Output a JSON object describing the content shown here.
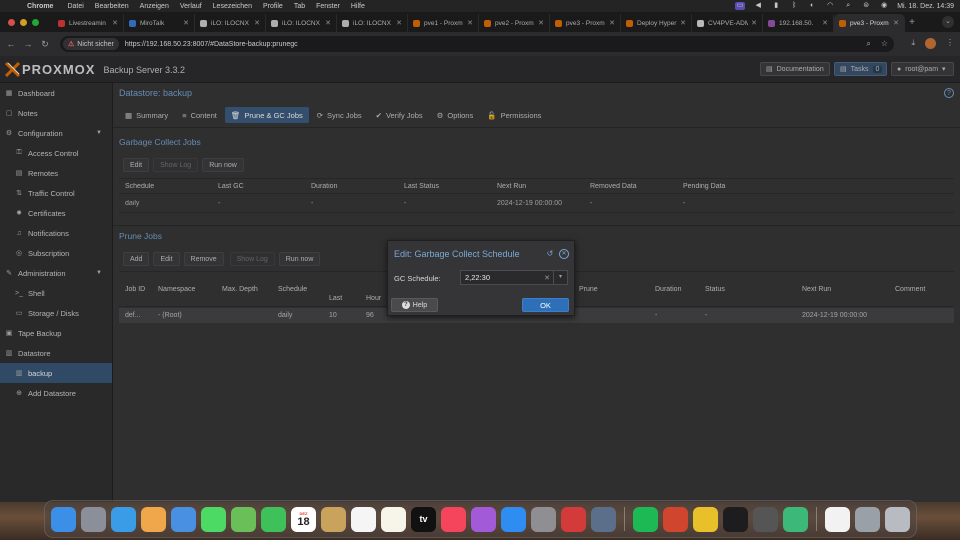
{
  "menubar": {
    "app": "Chrome",
    "items": [
      "Datei",
      "Bearbeiten",
      "Anzeigen",
      "Verlauf",
      "Lesezeichen",
      "Profile",
      "Tab",
      "Fenster",
      "Hilfe"
    ],
    "clock": "Mi. 18. Dez.  14:39"
  },
  "browser": {
    "tabs": [
      {
        "title": "Livestreamin",
        "color": "#e23b3b",
        "active": false
      },
      {
        "title": "MiroTalk",
        "color": "#3b7fe2",
        "active": false
      },
      {
        "title": "iLO: ILOCNX",
        "color": "#cfcfcf",
        "active": false
      },
      {
        "title": "iLO: ILOCNX",
        "color": "#cfcfcf",
        "active": false
      },
      {
        "title": "iLO: ILOCNX",
        "color": "#cfcfcf",
        "active": false
      },
      {
        "title": "pve1 - Proxm",
        "color": "#e57000",
        "active": false
      },
      {
        "title": "pve2 - Proxm",
        "color": "#e57000",
        "active": false
      },
      {
        "title": "pve3 - Proxm",
        "color": "#e57000",
        "active": false
      },
      {
        "title": "Deploy Hyper",
        "color": "#e57000",
        "active": false
      },
      {
        "title": "CV4PVE-ADM",
        "color": "#dddddd",
        "active": false
      },
      {
        "title": "192.168.50.",
        "color": "#9b59b6",
        "active": false
      },
      {
        "title": "pve3 - Proxm",
        "color": "#e57000",
        "active": true
      }
    ],
    "security_label": "Nicht sicher",
    "url": "https://192.168.50.23:8007/#DataStore-backup:prunegc"
  },
  "header": {
    "logo": "PROXMOX",
    "product": "Backup Server 3.3.2",
    "documentation": "Documentation",
    "tasks": "Tasks",
    "tasks_count": "0",
    "user": "root@pam"
  },
  "nav": {
    "items": [
      {
        "label": "Dashboard",
        "icon": "dashboard-icon",
        "glyph": "▦",
        "level": 0
      },
      {
        "label": "Notes",
        "icon": "notes-icon",
        "glyph": "▢",
        "level": 0
      },
      {
        "label": "Configuration",
        "icon": "gears-icon",
        "glyph": "⚙",
        "level": 0,
        "expanded": true
      },
      {
        "label": "Access Control",
        "icon": "key-icon",
        "glyph": "⚿",
        "level": 1
      },
      {
        "label": "Remotes",
        "icon": "server-icon",
        "glyph": "▤",
        "level": 1
      },
      {
        "label": "Traffic Control",
        "icon": "traffic-icon",
        "glyph": "⇅",
        "level": 1
      },
      {
        "label": "Certificates",
        "icon": "certificate-icon",
        "glyph": "✹",
        "level": 1
      },
      {
        "label": "Notifications",
        "icon": "bell-icon",
        "glyph": "♫",
        "level": 1
      },
      {
        "label": "Subscription",
        "icon": "support-icon",
        "glyph": "◎",
        "level": 1
      },
      {
        "label": "Administration",
        "icon": "wrench-icon",
        "glyph": "✎",
        "level": 0,
        "expanded": true
      },
      {
        "label": "Shell",
        "icon": "terminal-icon",
        "glyph": ">_",
        "level": 1
      },
      {
        "label": "Storage / Disks",
        "icon": "hdd-icon",
        "glyph": "▭",
        "level": 1
      },
      {
        "label": "Tape Backup",
        "icon": "tape-icon",
        "glyph": "▣",
        "level": 0
      },
      {
        "label": "Datastore",
        "icon": "database-icon",
        "glyph": "▥",
        "level": 0
      },
      {
        "label": "backup",
        "icon": "datastore-icon",
        "glyph": "▥",
        "level": 1,
        "selected": true
      },
      {
        "label": "Add Datastore",
        "icon": "plus-circle-icon",
        "glyph": "⊕",
        "level": 1
      }
    ]
  },
  "main": {
    "title": "Datastore: backup",
    "tabs": [
      {
        "label": "Summary",
        "icon": "book-icon",
        "glyph": "▦"
      },
      {
        "label": "Content",
        "icon": "list-icon",
        "glyph": "≡"
      },
      {
        "label": "Prune & GC Jobs",
        "icon": "trash-icon",
        "glyph": "🗑",
        "active": true
      },
      {
        "label": "Sync Jobs",
        "icon": "refresh-icon",
        "glyph": "⟳"
      },
      {
        "label": "Verify Jobs",
        "icon": "check-circle-icon",
        "glyph": "✔"
      },
      {
        "label": "Options",
        "icon": "gear-icon",
        "glyph": "⚙"
      },
      {
        "label": "Permissions",
        "icon": "unlock-icon",
        "glyph": "🔓"
      }
    ],
    "gc": {
      "title": "Garbage Collect Jobs",
      "buttons": [
        "Edit",
        "Show Log",
        "Run now"
      ],
      "columns": [
        "Schedule",
        "Last GC",
        "Duration",
        "Last Status",
        "Next Run",
        "Removed Data",
        "Pending Data"
      ],
      "row": [
        "daily",
        "-",
        "-",
        "-",
        "2024-12-19 00:00:00",
        "-",
        "-"
      ]
    },
    "prune": {
      "title": "Prune Jobs",
      "buttons": [
        "Add",
        "Edit",
        "Remove",
        "Show Log",
        "Run now"
      ],
      "columns": [
        "Job ID",
        "Namespace",
        "Max. Depth",
        "Schedule",
        "Last",
        "Hour",
        "Prune",
        "Duration",
        "Status",
        "Next Run",
        "Comment"
      ],
      "row": {
        "job_id": "def...",
        "namespace": "- (Root)",
        "max_depth": "",
        "schedule": "daily",
        "last": "10",
        "hour": "96",
        "duration": "-",
        "status": "-",
        "next_run": "2024-12-19 00:00:00"
      }
    }
  },
  "dialog": {
    "title": "Edit: Garbage Collect Schedule",
    "field_label": "GC Schedule:",
    "field_value": "2,22:30",
    "help": "Help",
    "ok": "OK"
  },
  "dock": {
    "calendar_month": "DEZ",
    "calendar_day": "18",
    "tv_label": "tv",
    "apps": [
      {
        "name": "finder-icon",
        "color": "#3b8fe6"
      },
      {
        "name": "launchpad-icon",
        "color": "#8a8f99"
      },
      {
        "name": "safari-icon",
        "color": "#3a9be6"
      },
      {
        "name": "photos-icon",
        "color": "#f0a64a"
      },
      {
        "name": "mail-icon",
        "color": "#4a90e2"
      },
      {
        "name": "messages-icon",
        "color": "#4cd964"
      },
      {
        "name": "maps-icon",
        "color": "#6bbf59"
      },
      {
        "name": "facetime-icon",
        "color": "#3fc15a"
      },
      {
        "name": "calendar-icon",
        "color": "#ffffff"
      },
      {
        "name": "notes-app-icon",
        "color": "#c9a25c"
      },
      {
        "name": "reminders-icon",
        "color": "#f5f5f5"
      },
      {
        "name": "freeform-icon",
        "color": "#f7f4ea"
      },
      {
        "name": "appletv-icon",
        "color": "#111111"
      },
      {
        "name": "music-icon",
        "color": "#f5455c"
      },
      {
        "name": "podcasts-icon",
        "color": "#a35ad8"
      },
      {
        "name": "appstore-icon",
        "color": "#2f8cf0"
      },
      {
        "name": "settings-icon",
        "color": "#8e8e93"
      },
      {
        "name": "screenrec-icon",
        "color": "#d33b3b"
      },
      {
        "name": "quicktime-icon",
        "color": "#5b6f8a"
      },
      {
        "name": "spotify-icon",
        "color": "#1db954"
      },
      {
        "name": "pixel-icon",
        "color": "#d0452e"
      },
      {
        "name": "chrome-icon",
        "color": "#e8c12a"
      },
      {
        "name": "terminal-icon",
        "color": "#1d1d1f"
      },
      {
        "name": "calculator-icon",
        "color": "#555555"
      },
      {
        "name": "sync-icon",
        "color": "#3cb878"
      },
      {
        "name": "document-icon",
        "color": "#f2f2f2"
      },
      {
        "name": "downloads-icon",
        "color": "#9aa0a8"
      },
      {
        "name": "trash-icon",
        "color": "#b8bcc2"
      }
    ]
  }
}
